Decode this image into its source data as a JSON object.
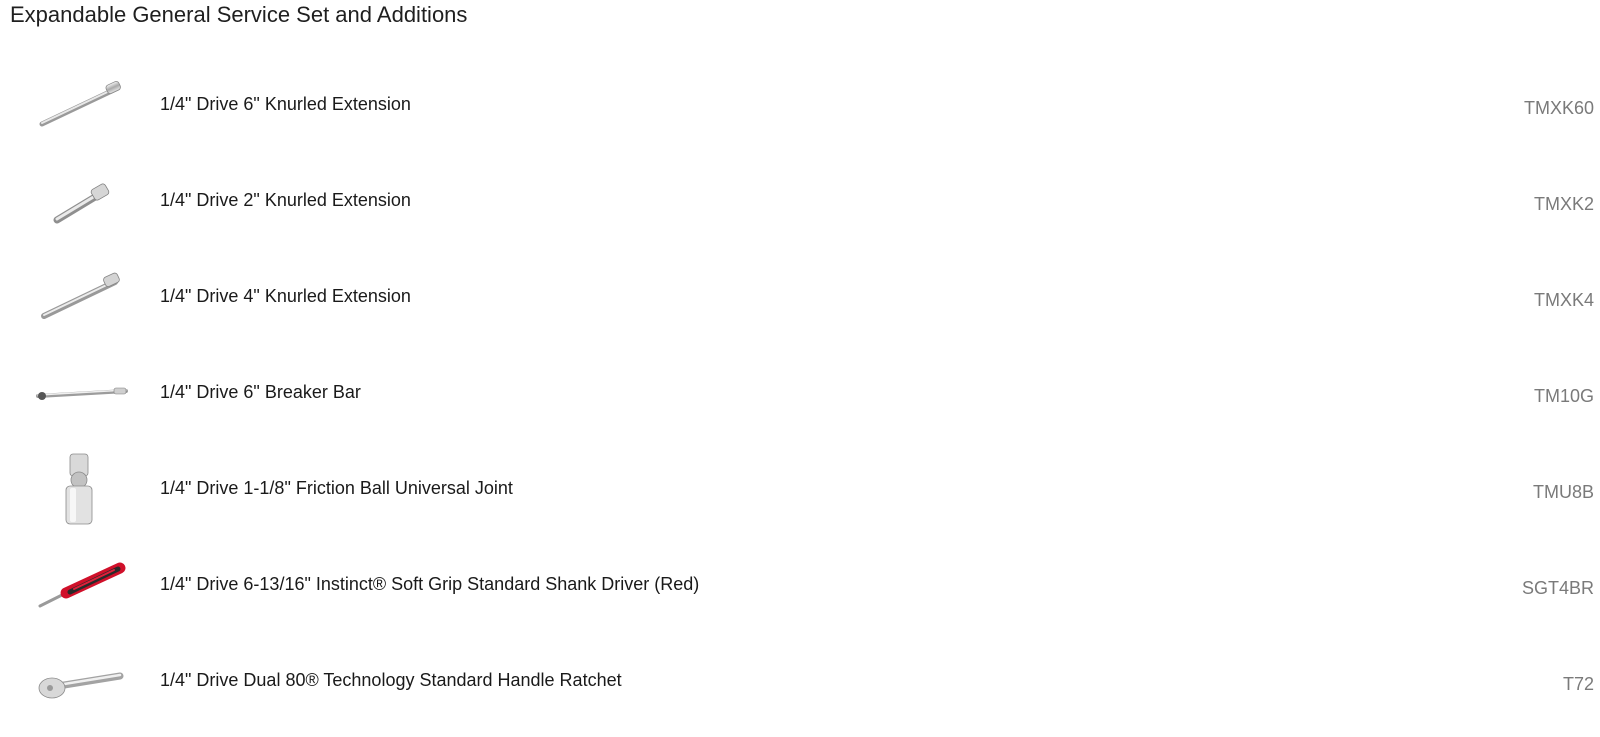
{
  "section": {
    "title": "Expandable General Service Set and Additions"
  },
  "items": [
    {
      "name": "1/4\" Drive 6\" Knurled Extension",
      "sku": "TMXK60",
      "icon": "knurled-extension-long-icon"
    },
    {
      "name": "1/4\" Drive 2\" Knurled Extension",
      "sku": "TMXK2",
      "icon": "knurled-extension-short-icon"
    },
    {
      "name": "1/4\" Drive 4\" Knurled Extension",
      "sku": "TMXK4",
      "icon": "knurled-extension-medium-icon"
    },
    {
      "name": "1/4\" Drive 6\" Breaker Bar",
      "sku": "TM10G",
      "icon": "breaker-bar-icon"
    },
    {
      "name": "1/4\" Drive 1-1/8\" Friction Ball Universal Joint",
      "sku": "TMU8B",
      "icon": "universal-joint-icon"
    },
    {
      "name": "1/4\" Drive 6-13/16\" Instinct® Soft Grip Standard Shank Driver (Red)",
      "sku": "SGT4BR",
      "icon": "shank-driver-icon"
    },
    {
      "name": "1/4\" Drive Dual 80® Technology Standard Handle Ratchet",
      "sku": "T72",
      "icon": "ratchet-icon"
    }
  ],
  "colors": {
    "text": "#1a1a1a",
    "sku": "#7a7a7a",
    "driver_grip": "#d0102a"
  }
}
